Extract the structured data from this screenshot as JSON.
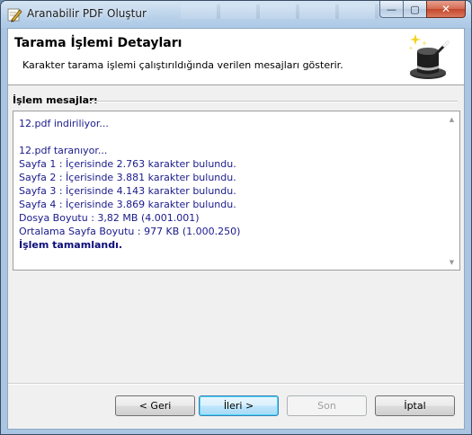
{
  "window": {
    "title": "Aranabilir PDF Oluştur"
  },
  "caption_buttons": {
    "minimize": "—",
    "maximize": "▢",
    "close": "✕"
  },
  "header": {
    "title": "Tarama İşlemi Detayları",
    "description": "Karakter tarama işlemi çalıştırıldığında verilen mesajları gösterir.",
    "icon": "magic-hat-icon"
  },
  "messages_group": {
    "label": "İşlem mesajları",
    "lines": [
      "12.pdf indiriliyor...",
      "",
      "12.pdf taranıyor...",
      "Sayfa 1 : İçerisinde 2.763 karakter bulundu.",
      "Sayfa 2 : İçerisinde 3.881 karakter bulundu.",
      "Sayfa 3 : İçerisinde 4.143 karakter bulundu.",
      "Sayfa 4 : İçerisinde 3.869 karakter bulundu.",
      "Dosya Boyutu : 3,82 MB (4.001.001)",
      "Ortalama Sayfa Boyutu : 977 KB (1.000.250)",
      "İşlem tamamlandı."
    ]
  },
  "buttons": {
    "back": "< Geri",
    "next": "İleri >",
    "finish": "Son",
    "cancel": "İptal"
  },
  "colors": {
    "message_text": "#1a1a8c",
    "window_frame": "#a9c5e2"
  }
}
